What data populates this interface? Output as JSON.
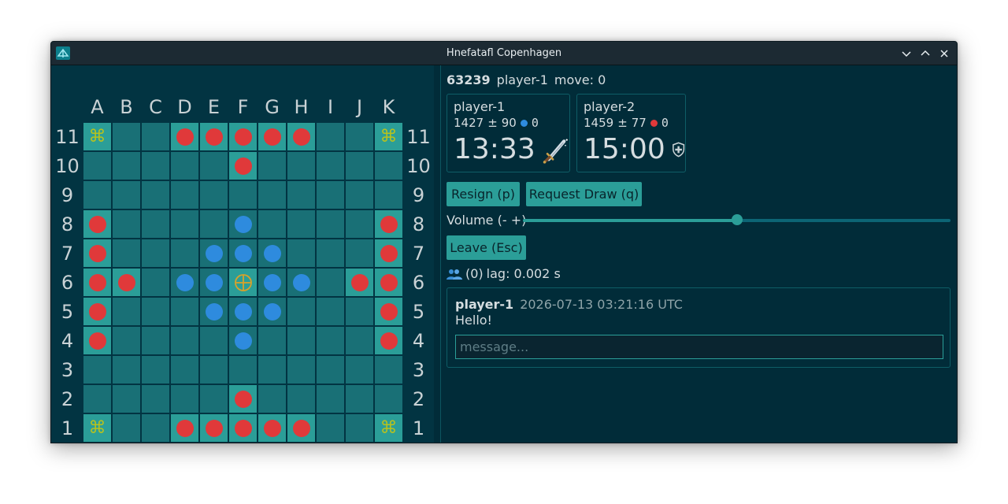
{
  "window": {
    "title": "Hnefatafl Copenhagen"
  },
  "board": {
    "columns": [
      "A",
      "B",
      "C",
      "D",
      "E",
      "F",
      "G",
      "H",
      "I",
      "J",
      "K"
    ],
    "rows": [
      "11",
      "10",
      "9",
      "8",
      "7",
      "6",
      "5",
      "4",
      "3",
      "2",
      "1"
    ],
    "special_cells": [
      [
        0,
        0
      ],
      [
        0,
        3
      ],
      [
        0,
        4
      ],
      [
        0,
        5
      ],
      [
        0,
        6
      ],
      [
        0,
        7
      ],
      [
        0,
        10
      ],
      [
        1,
        5
      ],
      [
        3,
        0
      ],
      [
        3,
        10
      ],
      [
        4,
        0
      ],
      [
        4,
        10
      ],
      [
        5,
        0
      ],
      [
        5,
        1
      ],
      [
        5,
        5
      ],
      [
        5,
        9
      ],
      [
        5,
        10
      ],
      [
        6,
        0
      ],
      [
        6,
        10
      ],
      [
        7,
        0
      ],
      [
        7,
        10
      ],
      [
        9,
        5
      ],
      [
        10,
        0
      ],
      [
        10,
        3
      ],
      [
        10,
        4
      ],
      [
        10,
        5
      ],
      [
        10,
        6
      ],
      [
        10,
        7
      ],
      [
        10,
        10
      ]
    ],
    "pieces": [
      {
        "r": 0,
        "c": 0,
        "t": "corner"
      },
      {
        "r": 0,
        "c": 10,
        "t": "corner"
      },
      {
        "r": 10,
        "c": 0,
        "t": "corner"
      },
      {
        "r": 10,
        "c": 10,
        "t": "corner"
      },
      {
        "r": 0,
        "c": 3,
        "t": "attacker"
      },
      {
        "r": 0,
        "c": 4,
        "t": "attacker"
      },
      {
        "r": 0,
        "c": 5,
        "t": "attacker"
      },
      {
        "r": 0,
        "c": 6,
        "t": "attacker"
      },
      {
        "r": 0,
        "c": 7,
        "t": "attacker"
      },
      {
        "r": 1,
        "c": 5,
        "t": "attacker"
      },
      {
        "r": 3,
        "c": 0,
        "t": "attacker"
      },
      {
        "r": 4,
        "c": 0,
        "t": "attacker"
      },
      {
        "r": 5,
        "c": 0,
        "t": "attacker"
      },
      {
        "r": 6,
        "c": 0,
        "t": "attacker"
      },
      {
        "r": 7,
        "c": 0,
        "t": "attacker"
      },
      {
        "r": 5,
        "c": 1,
        "t": "attacker"
      },
      {
        "r": 3,
        "c": 10,
        "t": "attacker"
      },
      {
        "r": 4,
        "c": 10,
        "t": "attacker"
      },
      {
        "r": 5,
        "c": 10,
        "t": "attacker"
      },
      {
        "r": 6,
        "c": 10,
        "t": "attacker"
      },
      {
        "r": 7,
        "c": 10,
        "t": "attacker"
      },
      {
        "r": 5,
        "c": 9,
        "t": "attacker"
      },
      {
        "r": 9,
        "c": 5,
        "t": "attacker"
      },
      {
        "r": 10,
        "c": 3,
        "t": "attacker"
      },
      {
        "r": 10,
        "c": 4,
        "t": "attacker"
      },
      {
        "r": 10,
        "c": 5,
        "t": "attacker"
      },
      {
        "r": 10,
        "c": 6,
        "t": "attacker"
      },
      {
        "r": 10,
        "c": 7,
        "t": "attacker"
      },
      {
        "r": 3,
        "c": 5,
        "t": "defender"
      },
      {
        "r": 4,
        "c": 4,
        "t": "defender"
      },
      {
        "r": 4,
        "c": 5,
        "t": "defender"
      },
      {
        "r": 4,
        "c": 6,
        "t": "defender"
      },
      {
        "r": 5,
        "c": 3,
        "t": "defender"
      },
      {
        "r": 5,
        "c": 4,
        "t": "defender"
      },
      {
        "r": 5,
        "c": 5,
        "t": "king"
      },
      {
        "r": 5,
        "c": 6,
        "t": "defender"
      },
      {
        "r": 5,
        "c": 7,
        "t": "defender"
      },
      {
        "r": 6,
        "c": 4,
        "t": "defender"
      },
      {
        "r": 6,
        "c": 5,
        "t": "defender"
      },
      {
        "r": 6,
        "c": 6,
        "t": "defender"
      },
      {
        "r": 7,
        "c": 5,
        "t": "defender"
      }
    ],
    "corner_glyph": "⌘",
    "colors": {
      "attacker": "#e0393a",
      "defender": "#2e8bde",
      "king": "#d8a22a",
      "corner": "#b7c21e"
    }
  },
  "game": {
    "id": "63239",
    "current_player": "player-1",
    "move_label": "move: 0"
  },
  "players": [
    {
      "name": "player-1",
      "rating": "1427",
      "pm": "±",
      "deviation": "90",
      "captures": "0",
      "color": "#2e8bde",
      "clock": "13:33",
      "role_icon": "dagger-icon"
    },
    {
      "name": "player-2",
      "rating": "1459",
      "pm": "±",
      "deviation": "77",
      "captures": "0",
      "color": "#e0393a",
      "clock": "15:00",
      "role_icon": "shield-icon"
    }
  ],
  "controls": {
    "resign_label": "Resign (p)",
    "draw_label": "Request Draw (q)",
    "volume_label": "Volume (- +)",
    "volume_value": 0.5,
    "leave_label": "Leave (Esc)"
  },
  "status": {
    "spectators": "(0)",
    "lag": "lag: 0.002 s"
  },
  "chat": {
    "messages": [
      {
        "user": "player-1",
        "time": "2026-07-13 03:21:16 UTC",
        "text": "Hello!"
      }
    ],
    "placeholder": "message..."
  }
}
